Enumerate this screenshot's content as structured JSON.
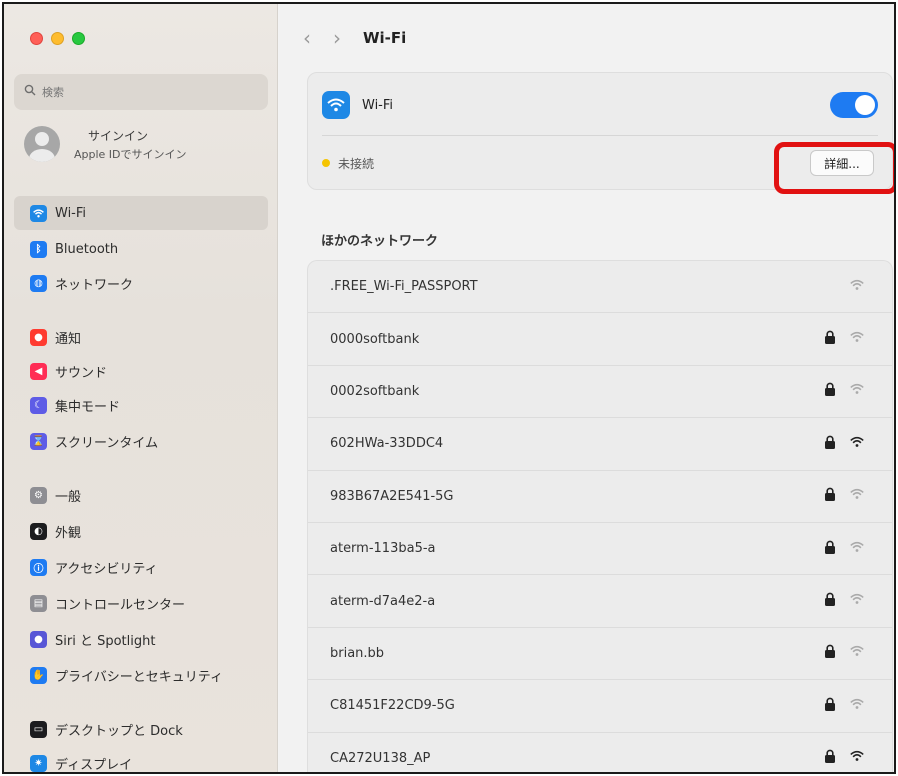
{
  "window": {
    "title": "Wi-Fi"
  },
  "sidebar": {
    "search_placeholder": "検索",
    "account": {
      "title": "サインイン",
      "subtitle": "Apple IDでサインイン"
    },
    "items": [
      {
        "label": "Wi-Fi",
        "icon": "wifi-icon",
        "color": "#1e88e5",
        "active": true
      },
      {
        "label": "Bluetooth",
        "icon": "bluetooth-icon",
        "color": "#1e7bf2"
      },
      {
        "label": "ネットワーク",
        "icon": "globe-icon",
        "color": "#1e7bf2"
      },
      {
        "label": "通知",
        "icon": "bell-icon",
        "color": "#ff3b30"
      },
      {
        "label": "サウンド",
        "icon": "speaker-icon",
        "color": "#ff2d55"
      },
      {
        "label": "集中モード",
        "icon": "moon-icon",
        "color": "#5e5ce6"
      },
      {
        "label": "スクリーンタイム",
        "icon": "hourglass-icon",
        "color": "#5e5ce6"
      },
      {
        "label": "一般",
        "icon": "gear-icon",
        "color": "#8e8e93"
      },
      {
        "label": "外観",
        "icon": "appearance-icon",
        "color": "#1c1c1e"
      },
      {
        "label": "アクセシビリティ",
        "icon": "accessibility-icon",
        "color": "#1e7bf2"
      },
      {
        "label": "コントロールセンター",
        "icon": "control-center-icon",
        "color": "#8e8e93"
      },
      {
        "label": "Siri と Spotlight",
        "icon": "siri-icon",
        "color": "#5856d6"
      },
      {
        "label": "プライバシーとセキュリティ",
        "icon": "hand-icon",
        "color": "#1e7bf2"
      },
      {
        "label": "デスクトップと Dock",
        "icon": "dock-icon",
        "color": "#1c1c1e"
      },
      {
        "label": "ディスプレイ",
        "icon": "sun-icon",
        "color": "#1e88e5"
      }
    ]
  },
  "main": {
    "wifi_label": "Wi-Fi",
    "wifi_on": true,
    "status_text": "未接続",
    "status_color": "#f5c400",
    "detail_button": "詳細...",
    "section_title": "ほかのネットワーク",
    "networks": [
      {
        "name": ".FREE_Wi-Fi_PASSPORT",
        "locked": false,
        "strength": "weak"
      },
      {
        "name": "0000softbank",
        "locked": true,
        "strength": "weak"
      },
      {
        "name": "0002softbank",
        "locked": true,
        "strength": "weak"
      },
      {
        "name": "602HWa-33DDC4",
        "locked": true,
        "strength": "strong"
      },
      {
        "name": "983B67A2E541-5G",
        "locked": true,
        "strength": "weak"
      },
      {
        "name": "aterm-113ba5-a",
        "locked": true,
        "strength": "weak"
      },
      {
        "name": "aterm-d7a4e2-a",
        "locked": true,
        "strength": "weak"
      },
      {
        "name": "brian.bb",
        "locked": true,
        "strength": "weak"
      },
      {
        "name": "C81451F22CD9-5G",
        "locked": true,
        "strength": "weak"
      },
      {
        "name": "CA272U138_AP",
        "locked": true,
        "strength": "strong"
      }
    ]
  },
  "colors": {
    "accent": "#1e7bf2",
    "highlight": "#e11111"
  }
}
